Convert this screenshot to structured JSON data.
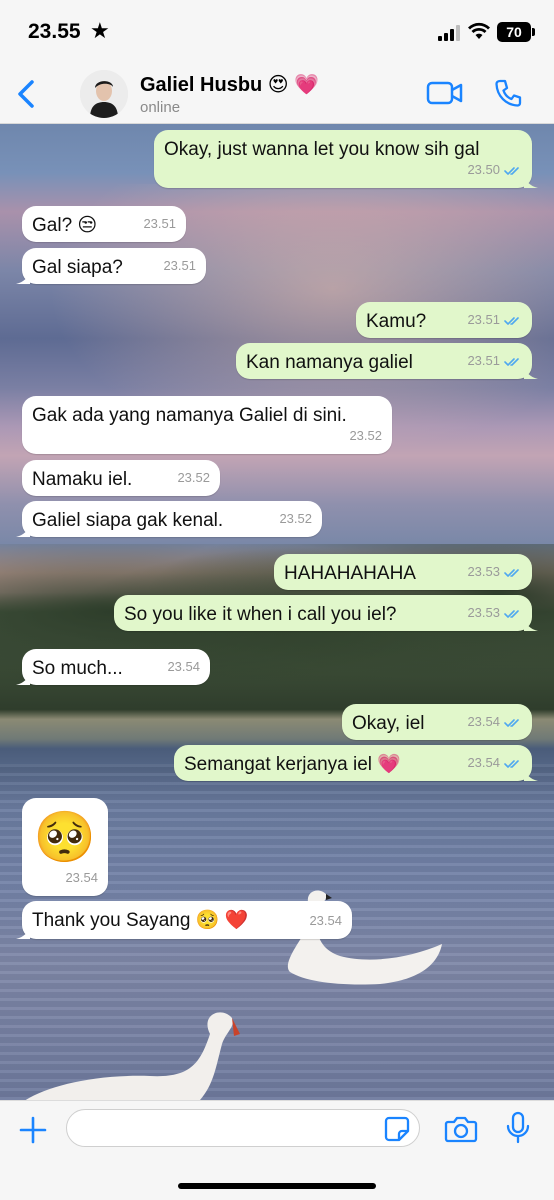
{
  "status_bar": {
    "time": "23.55",
    "star": "★",
    "battery": "70"
  },
  "header": {
    "name": "Galiel Husbu 😍 💗",
    "status": "online"
  },
  "messages": [
    {
      "dir": "out",
      "text": "Okay, just wanna let you know sih gal",
      "time": "23.50",
      "read": true
    },
    {
      "dir": "in",
      "text": "Gal? 😒",
      "time": "23.51"
    },
    {
      "dir": "in",
      "text": "Gal siapa?",
      "time": "23.51"
    },
    {
      "dir": "out",
      "text": "Kamu?",
      "time": "23.51",
      "read": true
    },
    {
      "dir": "out",
      "text": "Kan namanya galiel",
      "time": "23.51",
      "read": true
    },
    {
      "dir": "in",
      "text": "Gak ada yang namanya Galiel di sini.",
      "time": "23.52"
    },
    {
      "dir": "in",
      "text": "Namaku iel.",
      "time": "23.52"
    },
    {
      "dir": "in",
      "text": "Galiel siapa gak kenal.",
      "time": "23.52"
    },
    {
      "dir": "out",
      "text": "HAHAHAHAHA",
      "time": "23.53",
      "read": true
    },
    {
      "dir": "out",
      "text": "So you like it when i call you iel?",
      "time": "23.53",
      "read": true
    },
    {
      "dir": "in",
      "text": "So much...",
      "time": "23.54"
    },
    {
      "dir": "out",
      "text": "Okay, iel",
      "time": "23.54",
      "read": true
    },
    {
      "dir": "out",
      "text": "Semangat kerjanya iel 💗",
      "time": "23.54",
      "read": true
    },
    {
      "dir": "in",
      "text": "🥺",
      "time": "23.54",
      "emoji_only": true
    },
    {
      "dir": "in",
      "text": "Thank you Sayang 🥺 ❤️",
      "time": "23.54"
    }
  ],
  "composer": {
    "placeholder": ""
  },
  "colors": {
    "accent": "#1a84ff",
    "outgoing_bubble": "#e1f7cb",
    "incoming_bubble": "#ffffff",
    "read_ticks": "#4fa8f0"
  }
}
